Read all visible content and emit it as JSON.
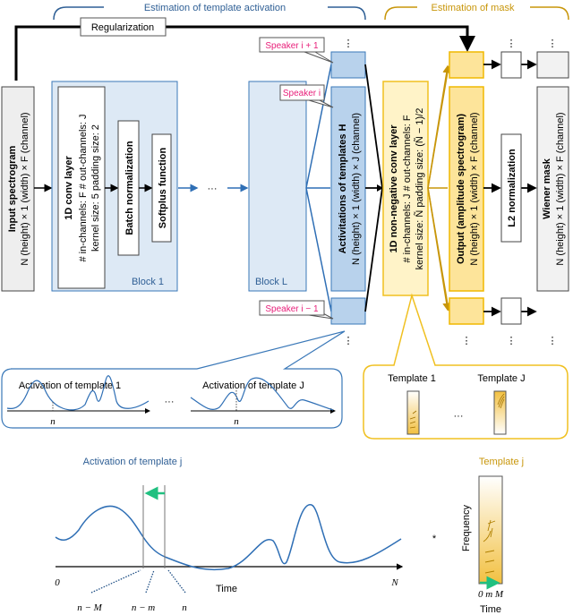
{
  "header": {
    "activation_section": "Estimation of template activation",
    "mask_section": "Estimation of mask",
    "regularization": "Regularization"
  },
  "input": {
    "title": "Input spectrogram",
    "dims": "N (height) × 1 (width) × F (channel)"
  },
  "block1": {
    "label": "Block 1",
    "conv_title": "1D conv layer",
    "conv_line1": "# in-channels: F  # out-channels: J",
    "conv_line2": "kernel size: 5  padding size: 2",
    "batch_norm": "Batch normalization",
    "softplus": "Softplus function"
  },
  "ellipsis": "···",
  "vdots": "⋮",
  "blockL": {
    "label": "Block L"
  },
  "speakers": {
    "next": "Speaker i + 1",
    "current": "Speaker i",
    "prev": "Speaker i − 1"
  },
  "activations": {
    "title": "Activitations of templates H",
    "dims": "N (height) × 1 (width) × J (channel)"
  },
  "nonneg_conv": {
    "title": "1D non-negative conv layer",
    "line1": "# in-channels: J  # out-channels: F",
    "line2": "kernel size: Ñ  padding size: (Ñ − 1)/2"
  },
  "output": {
    "title": "Output (amplitude spectrogram)",
    "dims": "N (height) × 1 (width) × F (channel)"
  },
  "l2": "L2 normalization",
  "wiener": {
    "title": "Wiener mask",
    "dims": "N (height) × 1 (width) × F (channel)"
  },
  "activation_panel": {
    "plot1_title": "Activation of template 1",
    "plotJ_title": "Activation of template J",
    "n_label": "n"
  },
  "template_panel": {
    "template1": "Template 1",
    "templateJ": "Template J"
  },
  "detail": {
    "activation_title": "Activation of template j",
    "x_start": "0",
    "x_end": "N",
    "x_label": "Time",
    "n_minus_M": "n − M",
    "n_minus_m": "n − m",
    "n": "n",
    "conv_symbol": "*",
    "template_title": "Template j",
    "freq_label": "Frequency",
    "template_axis": "0 m M",
    "template_time": "Time"
  },
  "colors": {
    "blue": "#2f6fb5",
    "light_blue": "#dde9f5",
    "gold": "#f0c020",
    "light_gold": "#fff3c8",
    "pink": "#e8207a",
    "green": "#20c080"
  }
}
